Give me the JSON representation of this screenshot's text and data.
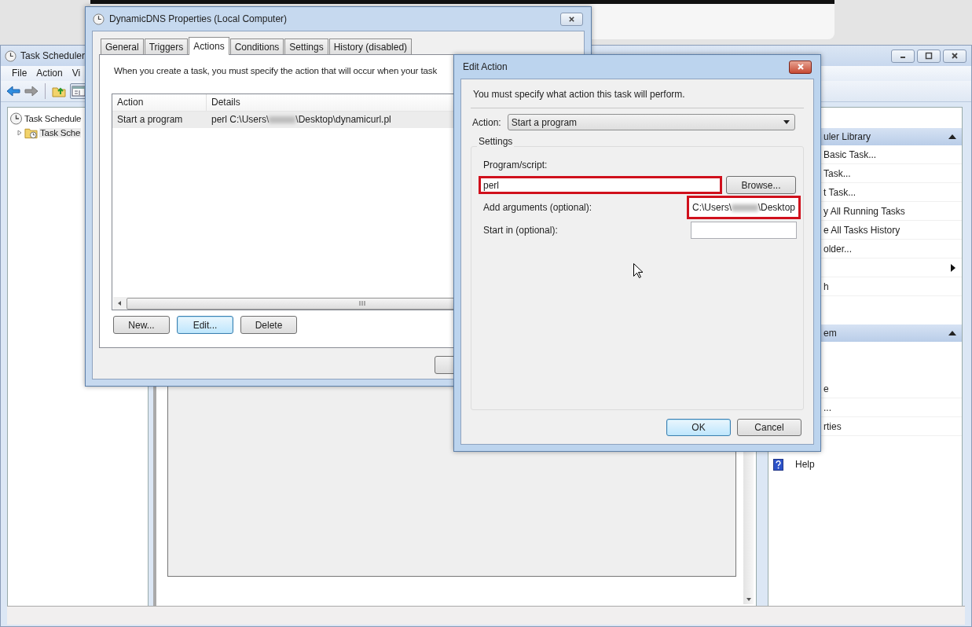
{
  "main_window": {
    "title": "Task Scheduler",
    "menu": [
      "File",
      "Action",
      "Vi"
    ],
    "tree": [
      {
        "label": "Task Schedule",
        "children": [
          {
            "label": "Task Sche",
            "expanded": false
          }
        ]
      }
    ],
    "actions_pane": {
      "sections": [
        {
          "header": "uler Library",
          "expanded": true,
          "items": [
            {
              "kind": "action",
              "label": "Basic Task..."
            },
            {
              "kind": "action",
              "label": "Task..."
            },
            {
              "kind": "action",
              "label": "t Task..."
            },
            {
              "kind": "action",
              "label": "y All Running Tasks"
            },
            {
              "kind": "action",
              "label": "e All Tasks History"
            },
            {
              "kind": "action",
              "label": "older..."
            },
            {
              "kind": "submenu"
            },
            {
              "kind": "action",
              "label": "h"
            }
          ]
        },
        {
          "header": "em",
          "expanded": true,
          "items": [
            {
              "kind": "action",
              "label": "e"
            },
            {
              "kind": "action",
              "label": "..."
            },
            {
              "kind": "action",
              "label": "rties"
            }
          ]
        }
      ],
      "help": "Help"
    }
  },
  "properties_dialog": {
    "title": "DynamicDNS Properties (Local Computer)",
    "tabs": [
      {
        "label": "General",
        "selected": false
      },
      {
        "label": "Triggers",
        "selected": false
      },
      {
        "label": "Actions",
        "selected": true
      },
      {
        "label": "Conditions",
        "selected": false
      },
      {
        "label": "Settings",
        "selected": false
      },
      {
        "label": "History (disabled)",
        "selected": false
      }
    ],
    "description": "When you create a task, you must specify the action that will occur when your task",
    "table": {
      "columns": [
        "Action",
        "Details"
      ],
      "rows": [
        {
          "action": "Start a program",
          "details_before": "perl C:\\Users\\",
          "details_after": "\\Desktop\\dynamicurl.pl",
          "selected": true
        }
      ]
    },
    "buttons": [
      {
        "label": "New...",
        "focused": false
      },
      {
        "label": "Edit...",
        "focused": true
      },
      {
        "label": "Delete",
        "focused": false
      }
    ]
  },
  "edit_action_dialog": {
    "title": "Edit Action",
    "intro": "You must specify what action this task will perform.",
    "action": {
      "label": "Action:",
      "value": "Start a program"
    },
    "settings": {
      "legend": "Settings",
      "program": {
        "label": "Program/script:",
        "value": "perl",
        "highlighted": true,
        "button": "Browse..."
      },
      "arguments": {
        "label": "Add arguments (optional):",
        "value_before": "C:\\Users\\",
        "value_after": "\\Desktop",
        "highlighted": true
      },
      "start_in": {
        "label": "Start in (optional):",
        "highlighted": false
      }
    },
    "buttons": [
      {
        "label": "OK",
        "focused": true
      },
      {
        "label": "Cancel",
        "focused": false
      }
    ]
  }
}
